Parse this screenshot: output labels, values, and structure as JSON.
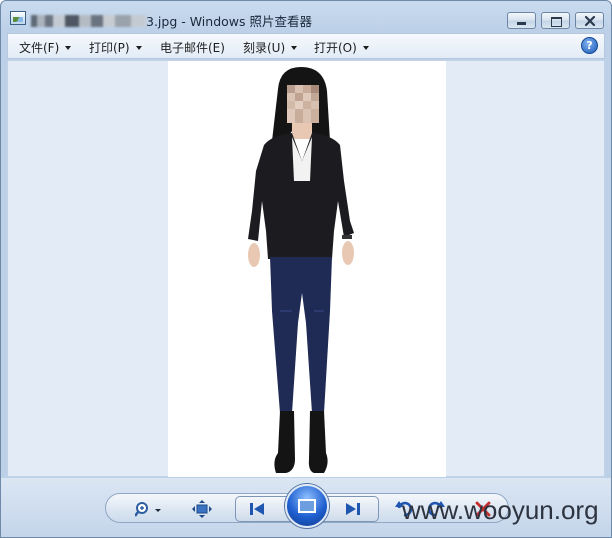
{
  "window": {
    "title_prefix": "",
    "title_suffix": "3.jpg - Windows 照片查看器"
  },
  "menu": {
    "items": [
      {
        "label": "文件(F)"
      },
      {
        "label": "打印(P)"
      },
      {
        "label": "电子邮件(E)"
      },
      {
        "label": "刻录(U)"
      },
      {
        "label": "打开(O)"
      }
    ],
    "help_label": "?"
  },
  "toolbar": {
    "buttons": [
      "zoom-icon",
      "fit-to-window-icon",
      "previous-icon",
      "slideshow-icon",
      "next-icon",
      "rotate-counterclockwise-icon",
      "rotate-clockwise-icon",
      "delete-icon"
    ]
  },
  "watermark": {
    "text": "www.wooyun.org"
  }
}
